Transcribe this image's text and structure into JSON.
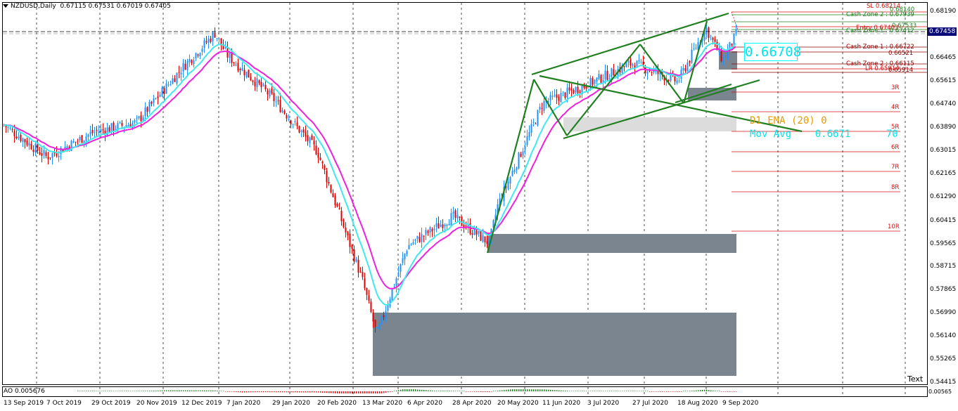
{
  "header": {
    "symbol": "NZDUSD,Daily",
    "ohlc": "0.67115 0.67531 0.67019 0.67405"
  },
  "price_axis": {
    "labels": [
      "0.68190",
      "0.67460",
      "0.66465",
      "0.65615",
      "0.64740",
      "0.63890",
      "0.63015",
      "0.62165",
      "0.61290",
      "0.60415",
      "0.59565",
      "0.58715",
      "0.57865",
      "0.56990",
      "0.56140",
      "0.55265",
      "0.54415"
    ],
    "current_price": "0.67458"
  },
  "time_axis": {
    "labels": [
      "13 Sep 2019",
      "7 Oct 2019",
      "29 Oct 2019",
      "20 Nov 2019",
      "12 Dec 2019",
      "7 Jan 2020",
      "29 Jan 2020",
      "20 Feb 2020",
      "13 Mar 2020",
      "6 Apr 2020",
      "28 Apr 2020",
      "20 May 2020",
      "11 Jun 2020",
      "3 Jul 2020",
      "27 Jul 2020",
      "18 Aug 2020",
      "9 Sep 2020"
    ]
  },
  "levels": {
    "sl": "SL 0.68214",
    "sl_val": "0.68140",
    "cash_zone_2_top": "Cash Zone 2 : 0.67939",
    "level_67533": "0.67533",
    "entry": "Entry 0.67403",
    "cash_zone_1_top": "Cash Zone 1 : 0.67412",
    "cash_zone_1": "Cash Zone 1 : 0.66722",
    "level_66521": "0.66521",
    "cash_zone_2": "Cash Zone 2 : 0.66115",
    "lr": "LR 0.65914",
    "level_65914": "0.65914",
    "r_labels": [
      "3R",
      "4R",
      "5R",
      "6R",
      "7R",
      "8R",
      "10R"
    ]
  },
  "indicators": {
    "big_value": "0.66708",
    "ema_text": "D1 EMA (20) 0",
    "mov_avg_text": "Mov Avg    0.6671",
    "mov_avg_extra": "70"
  },
  "ao": {
    "label": "AO 0.005676",
    "axis_value": "0.00565"
  },
  "text_marker": "Text",
  "colors": {
    "bull": "#1e90ff",
    "bear": "#e00000",
    "ema_fast": "#40e8f0",
    "ema_slow": "#ee22dd",
    "pattern": "#208020",
    "zone": "#7a8590",
    "zone_light": "#dcdcdc",
    "level_red": "#d01010"
  },
  "chart_data": {
    "type": "candlestick",
    "symbol": "NZDUSD",
    "timeframe": "Daily",
    "ylim": [
      0.54415,
      0.6819
    ],
    "x_labels": [
      "13 Sep 2019",
      "7 Oct 2019",
      "29 Oct 2019",
      "20 Nov 2019",
      "12 Dec 2019",
      "7 Jan 2020",
      "29 Jan 2020",
      "20 Feb 2020",
      "13 Mar 2020",
      "6 Apr 2020",
      "28 Apr 2020",
      "20 May 2020",
      "11 Jun 2020",
      "3 Jul 2020",
      "27 Jul 2020",
      "18 Aug 2020",
      "9 Sep 2020"
    ],
    "last_ohlc": {
      "open": 0.67115,
      "high": 0.67531,
      "low": 0.67019,
      "close": 0.67405
    },
    "close_path": [
      {
        "date": "13 Sep 2019",
        "close": 0.64
      },
      {
        "date": "7 Oct 2019",
        "close": 0.628
      },
      {
        "date": "29 Oct 2019",
        "close": 0.637
      },
      {
        "date": "20 Nov 2019",
        "close": 0.641
      },
      {
        "date": "12 Dec 2019",
        "close": 0.661
      },
      {
        "date": "31 Dec 2019",
        "close": 0.674
      },
      {
        "date": "7 Jan 2020",
        "close": 0.666
      },
      {
        "date": "29 Jan 2020",
        "close": 0.65
      },
      {
        "date": "20 Feb 2020",
        "close": 0.63
      },
      {
        "date": "13 Mar 2020",
        "close": 0.582
      },
      {
        "date": "19 Mar 2020",
        "close": 0.562
      },
      {
        "date": "6 Apr 2020",
        "close": 0.595
      },
      {
        "date": "28 Apr 2020",
        "close": 0.606
      },
      {
        "date": "15 May 2020",
        "close": 0.596
      },
      {
        "date": "20 May 2020",
        "close": 0.61
      },
      {
        "date": "11 Jun 2020",
        "close": 0.648
      },
      {
        "date": "3 Jul 2020",
        "close": 0.655
      },
      {
        "date": "27 Jul 2020",
        "close": 0.663
      },
      {
        "date": "18 Aug 2020",
        "close": 0.656
      },
      {
        "date": "31 Aug 2020",
        "close": 0.676
      },
      {
        "date": "9 Sep 2020",
        "close": 0.664
      },
      {
        "date": "16 Sep 2020",
        "close": 0.674
      }
    ]
  }
}
